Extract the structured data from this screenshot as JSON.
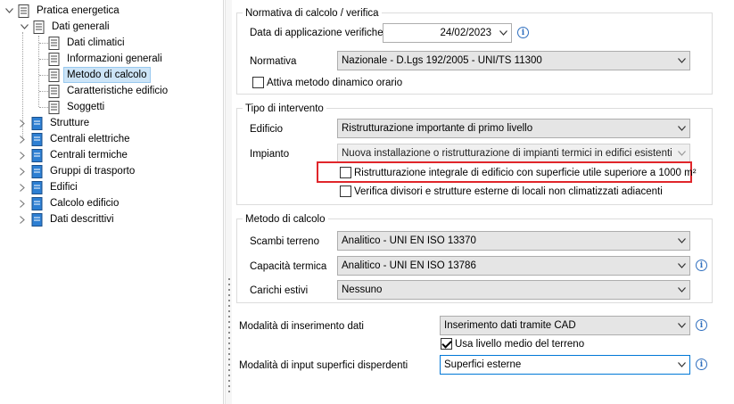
{
  "tree": {
    "root": "Pratica energetica",
    "dati_generali": "Dati generali",
    "children": [
      "Dati climatici",
      "Informazioni generali",
      "Metodo di calcolo",
      "Caratteristiche edificio",
      "Soggetti"
    ],
    "sections": [
      "Strutture",
      "Centrali elettriche",
      "Centrali termiche",
      "Gruppi di trasporto",
      "Edifici",
      "Calcolo edificio",
      "Dati descrittivi"
    ],
    "selected": "Metodo di calcolo"
  },
  "normativa_group": {
    "title": "Normativa di calcolo / verifica",
    "date_label": "Data di applicazione verifiche",
    "date_value": "24/02/2023",
    "normativa_label": "Normativa",
    "normativa_value": "Nazionale - D.Lgs 192/2005 - UNI/TS 11300",
    "dynamic_label": "Attiva metodo dinamico orario",
    "dynamic_checked": false
  },
  "intervento_group": {
    "title": "Tipo di intervento",
    "edificio_label": "Edificio",
    "edificio_value": "Ristrutturazione importante di primo livello",
    "impianto_label": "Impianto",
    "impianto_value": "Nuova installazione o ristrutturazione di impianti termici in edifici esistenti",
    "ristrutturazione_label": "Ristrutturazione integrale di edificio con superficie utile superiore a 1000 m²",
    "ristrutturazione_checked": false,
    "verifica_label": "Verifica divisori e strutture esterne di locali non climatizzati adiacenti",
    "verifica_checked": false,
    "highlight_color": "#e0262b"
  },
  "metodo_group": {
    "title": "Metodo di calcolo",
    "scambi_label": "Scambi terreno",
    "scambi_value": "Analitico - UNI EN ISO 13370",
    "capacita_label": "Capacità termica",
    "capacita_value": "Analitico - UNI EN ISO 13786",
    "carichi_label": "Carichi estivi",
    "carichi_value": "Nessuno"
  },
  "bottom": {
    "modalita_label": "Modalità di inserimento dati",
    "modalita_value": "Inserimento dati tramite CAD",
    "livello_label": "Usa livello medio del terreno",
    "livello_checked": true,
    "input_label": "Modalità di input superfici disperdenti",
    "input_value": "Superfici esterne"
  },
  "icons": {
    "info": "i",
    "chevron": "chevron-down-icon",
    "tree_doc": "document-icon"
  },
  "colors": {
    "accent": "#0078d7",
    "selected_bg": "#cce4f7",
    "info": "#2f6fbf"
  }
}
